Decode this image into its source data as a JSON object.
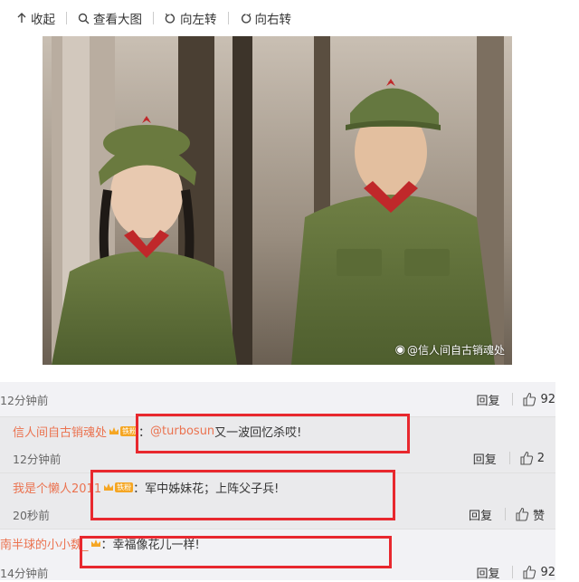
{
  "toolbar": {
    "collapse": "收起",
    "view_large": "查看大图",
    "rotate_left": "向左转",
    "rotate_right": "向右转"
  },
  "photo": {
    "watermark": "@信人间自古销魂处"
  },
  "main_comment": {
    "time": "12分钟前",
    "reply": "回复",
    "likes": "92"
  },
  "replies": [
    {
      "user": "信人间自古销魂处",
      "badge": "铁粉",
      "mention": "@turbosun",
      "text": " 又一波回忆杀哎!",
      "time": "12分钟前",
      "reply": "回复",
      "likes": "2"
    },
    {
      "user": "我是个懒人2011",
      "badge": "铁粉",
      "text": "军中姊妹花；上阵父子兵!",
      "time": "20秒前",
      "reply": "回复",
      "likes": "赞"
    },
    {
      "user": "南半球的小小魏_",
      "badge": "",
      "text": "幸福像花儿一样!",
      "time": "14分钟前",
      "reply": "回复",
      "likes": "92"
    }
  ],
  "colors": {
    "username": "#eb7350",
    "highlight": "#e8282e",
    "comment_bg": "#f2f2f5"
  }
}
